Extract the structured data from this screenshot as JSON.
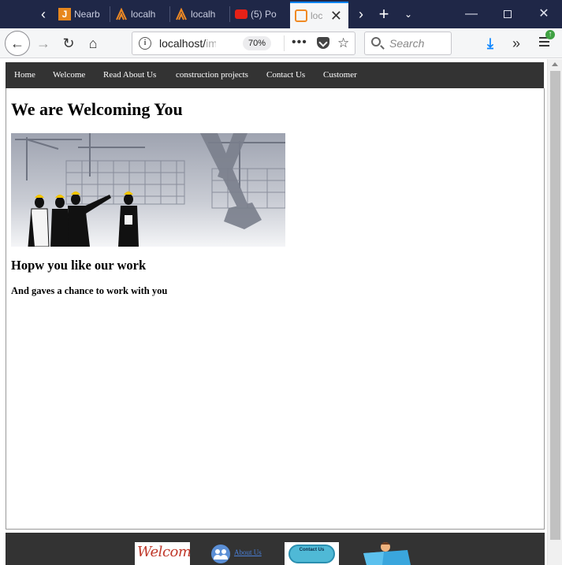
{
  "browser": {
    "tabs": [
      {
        "label": "Nearb",
        "icon": "j-icon"
      },
      {
        "label": "localh",
        "icon": "xampp-icon"
      },
      {
        "label": "localh",
        "icon": "xampp-icon"
      },
      {
        "label": "(5) Po",
        "icon": "youtube-icon"
      },
      {
        "label": "loc",
        "icon": "xampp-icon",
        "active": true
      }
    ],
    "url_host": "localhost/",
    "url_path": "im",
    "zoom": "70%",
    "search_placeholder": "Search",
    "menu_badge": "↑"
  },
  "site": {
    "nav": [
      "Home",
      "Welcome",
      "Read About Us",
      "construction projects",
      "Contact Us",
      "Customer"
    ],
    "heading": "We are Welcoming You",
    "subheading": "Hopw you like our work",
    "tagline": "And gaves a chance to work with you",
    "footer": {
      "welcome_img_text": "Welcome!",
      "about_link": "About Us",
      "contact_img_text": "Contact Us"
    }
  },
  "colors": {
    "tabbar": "#1f2747",
    "site_nav": "#333333",
    "accent": "#0a84ff"
  }
}
